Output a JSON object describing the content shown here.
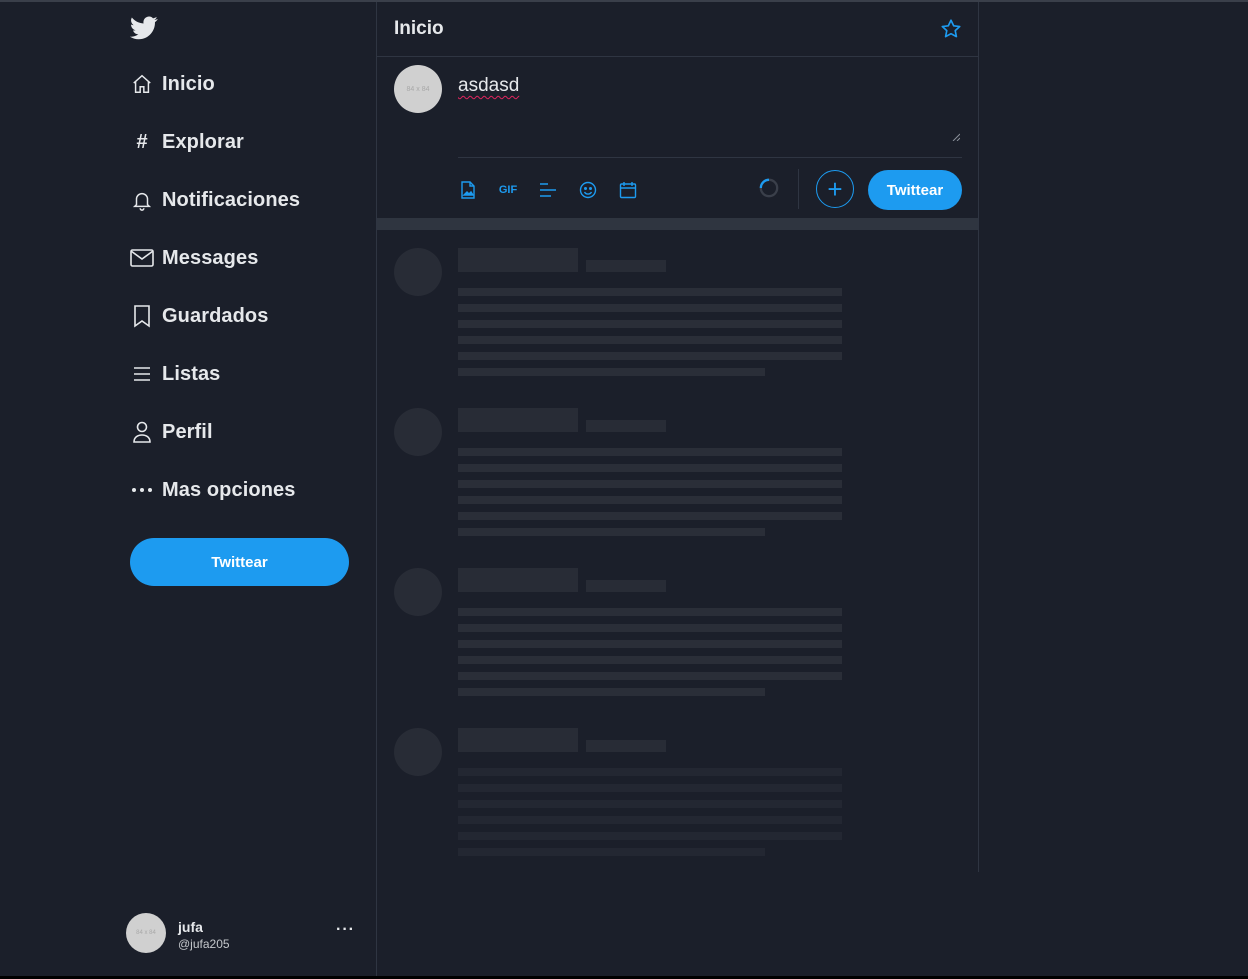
{
  "sidebar": {
    "logo_icon": "twitter-bird-icon",
    "items": [
      {
        "label": "Inicio",
        "icon": "home-icon"
      },
      {
        "label": "Explorar",
        "icon": "hashtag-icon"
      },
      {
        "label": "Notificaciones",
        "icon": "bell-icon"
      },
      {
        "label": "Messages",
        "icon": "envelope-icon"
      },
      {
        "label": "Guardados",
        "icon": "bookmark-icon"
      },
      {
        "label": "Listas",
        "icon": "list-icon"
      },
      {
        "label": "Perfil",
        "icon": "person-icon"
      },
      {
        "label": "Mas opciones",
        "icon": "more-dots-icon"
      }
    ],
    "tweet_button": "Twittear",
    "account": {
      "avatar_text": "84 x 84",
      "name": "jufa",
      "handle": "@jufa205",
      "more": "···"
    }
  },
  "main": {
    "title": "Inicio",
    "composer": {
      "avatar_text": "84 x 84",
      "text": "asdasd",
      "tools": [
        "image-icon",
        "gif-icon",
        "poll-icon",
        "emoji-icon",
        "schedule-icon"
      ],
      "gif_label": "GIF",
      "plus_label": "+",
      "tweet_button": "Twittear"
    },
    "skeleton_count": 4
  },
  "colors": {
    "background": "#1b1f2a",
    "accent": "#1d9bf0",
    "skeleton": "#282c36",
    "border": "#2f3542"
  }
}
